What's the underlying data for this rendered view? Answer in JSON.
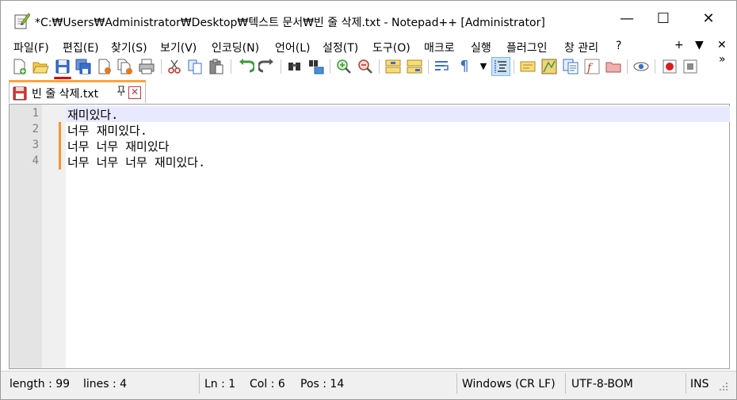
{
  "window": {
    "title": "*C:₩Users₩Administrator₩Desktop₩텍스트 문서₩빈 줄 삭제.txt - Notepad++ [Administrator]",
    "minimize_glyph": "—",
    "maximize_glyph": "☐",
    "close_glyph": "✕"
  },
  "menu": {
    "items": [
      "파일(F)",
      "편집(E)",
      "찾기(S)",
      "보기(V)",
      "인코딩(N)",
      "언어(L)",
      "설정(T)",
      "도구(O)",
      "매크로",
      "실행",
      "플러그인",
      "창 관리",
      "?"
    ],
    "right_plus": "+",
    "right_arrow": "▼",
    "right_close": "✕",
    "overflow": "»"
  },
  "toolbar": {
    "icons": [
      "new-file-icon",
      "open-file-icon",
      "save-icon",
      "save-all-icon",
      "close-icon",
      "close-all-icon",
      "print-icon",
      "cut-icon",
      "copy-icon",
      "paste-icon",
      "undo-icon",
      "redo-icon",
      "find-icon",
      "replace-icon",
      "zoom-in-icon",
      "zoom-out-icon",
      "sync-vertical-icon",
      "sync-horizontal-icon",
      "word-wrap-icon",
      "show-all-chars-icon",
      "indent-guide-icon",
      "doc-map-icon",
      "function-list-icon",
      "folder-workspace-icon",
      "monitoring-icon",
      "record-macro-icon",
      "stop-record-icon"
    ],
    "pilcrow": "¶"
  },
  "tab": {
    "label": "빈 줄 삭제.txt",
    "pin": "✎",
    "close": "✕"
  },
  "editor": {
    "line_numbers": [
      "1",
      "2",
      "3",
      "4"
    ],
    "lines": [
      "재미있다.",
      "너무 재미있다.",
      "너무 너무 재미있다",
      "너무 너무 너무 재미있다."
    ]
  },
  "status": {
    "length": "length : 99",
    "lines": "lines : 4",
    "ln": "Ln : 1",
    "col": "Col : 6",
    "pos": "Pos : 14",
    "eol": "Windows (CR LF)",
    "encoding": "UTF-8-BOM",
    "mode": "INS"
  },
  "colors": {
    "accent_tab": "#f6a445",
    "change_marker": "#f39535",
    "current_line": "#e8e8ff",
    "save_underline": "#e00000"
  }
}
